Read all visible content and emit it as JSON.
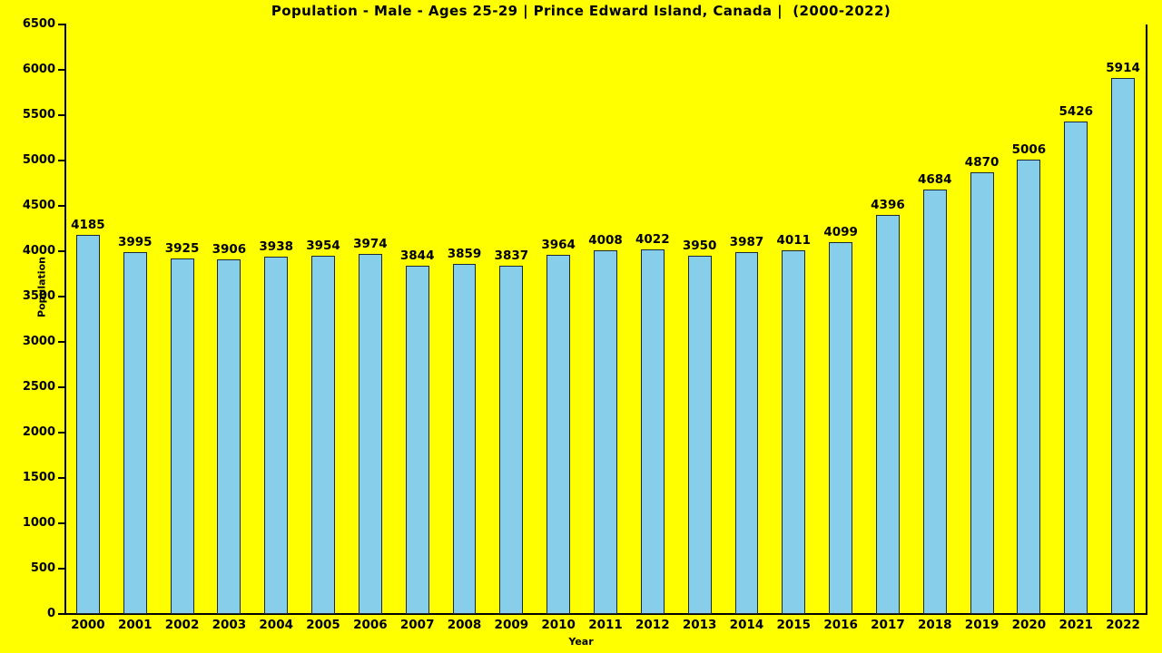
{
  "chart_data": {
    "type": "bar",
    "title": "Population - Male - Ages 25-29 | Prince Edward Island, Canada |  (2000-2022)",
    "xlabel": "Year",
    "ylabel": "Population",
    "categories": [
      "2000",
      "2001",
      "2002",
      "2003",
      "2004",
      "2005",
      "2006",
      "2007",
      "2008",
      "2009",
      "2010",
      "2011",
      "2012",
      "2013",
      "2014",
      "2015",
      "2016",
      "2017",
      "2018",
      "2019",
      "2020",
      "2021",
      "2022"
    ],
    "values": [
      4185,
      3995,
      3925,
      3906,
      3938,
      3954,
      3974,
      3844,
      3859,
      3837,
      3964,
      4008,
      4022,
      3950,
      3987,
      4011,
      4099,
      4396,
      4684,
      4870,
      5006,
      5426,
      5914
    ],
    "value_labels": [
      "4185",
      "3995",
      "3925",
      "3906",
      "3938",
      "3954",
      "3974",
      "3844",
      "3859",
      "3837",
      "3964",
      "4008",
      "4022",
      "3950",
      "3987",
      "4011",
      "4099",
      "4396",
      "4684",
      "4870",
      "5006",
      "5426",
      "5914"
    ],
    "ylim": [
      0,
      6500
    ],
    "yticks": [
      0,
      500,
      1000,
      1500,
      2000,
      2500,
      3000,
      3500,
      4000,
      4500,
      5000,
      5500,
      6000,
      6500
    ],
    "ytick_labels": [
      "0",
      "500",
      "1000",
      "1500",
      "2000",
      "2500",
      "3000",
      "3500",
      "4000",
      "4500",
      "5000",
      "5500",
      "6000",
      "6500"
    ],
    "grid": false,
    "legend": null,
    "colors": {
      "background": "#FFFF00",
      "bar_fill": "#87CEEB",
      "bar_edge": "#1b2838",
      "text": "#000000",
      "axis": "#000000"
    }
  }
}
